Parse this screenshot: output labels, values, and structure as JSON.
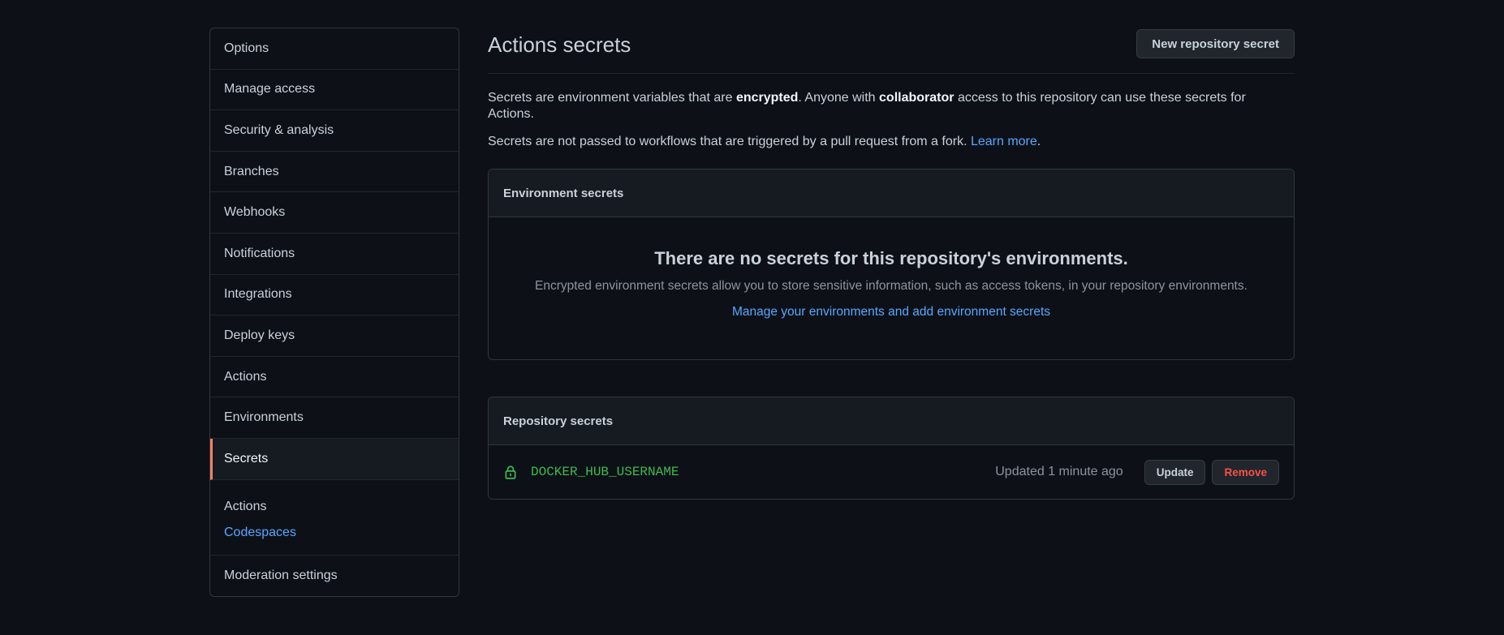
{
  "sidebar": {
    "items": [
      {
        "label": "Options"
      },
      {
        "label": "Manage access"
      },
      {
        "label": "Security & analysis"
      },
      {
        "label": "Branches"
      },
      {
        "label": "Webhooks"
      },
      {
        "label": "Notifications"
      },
      {
        "label": "Integrations"
      },
      {
        "label": "Deploy keys"
      },
      {
        "label": "Actions"
      },
      {
        "label": "Environments"
      },
      {
        "label": "Secrets",
        "active": true
      }
    ],
    "group": {
      "title": "Actions",
      "link": "Codespaces"
    },
    "last_item": "Moderation settings"
  },
  "main": {
    "title": "Actions secrets",
    "new_secret_button": "New repository secret",
    "desc1": {
      "part1": "Secrets are environment variables that are ",
      "bold1": "encrypted",
      "part2": ". Anyone with ",
      "bold2": "collaborator",
      "part3": " access to this repository can use these secrets for Actions."
    },
    "desc2": {
      "text": "Secrets are not passed to workflows that are triggered by a pull request from a fork. ",
      "link": "Learn more",
      "end": "."
    },
    "environment_secrets": {
      "heading": "Environment secrets",
      "blank_title": "There are no secrets for this repository's environments.",
      "blank_desc": "Encrypted environment secrets allow you to store sensitive information, such as access tokens, in your repository environments.",
      "blank_link": "Manage your environments and add environment secrets"
    },
    "repository_secrets": {
      "heading": "Repository secrets",
      "rows": [
        {
          "icon": "lock-icon",
          "name": "DOCKER_HUB_USERNAME",
          "updated": "Updated 1 minute ago",
          "update_label": "Update",
          "remove_label": "Remove"
        }
      ]
    }
  },
  "colors": {
    "background": "#0d1117",
    "link": "#58a6ff",
    "secret_name": "#3fb950",
    "danger": "#f85149",
    "active_marker": "#f78166"
  }
}
